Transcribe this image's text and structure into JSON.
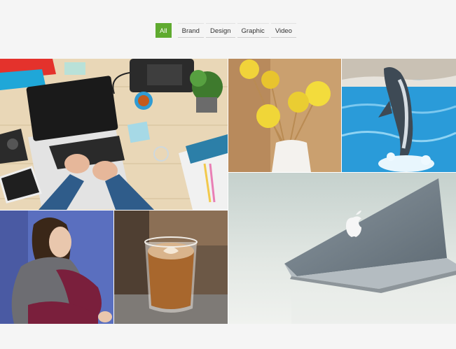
{
  "filters": [
    {
      "label": "All",
      "active": true
    },
    {
      "label": "Brand",
      "active": false
    },
    {
      "label": "Design",
      "active": false
    },
    {
      "label": "Graphic",
      "active": false
    },
    {
      "label": "Video",
      "active": false
    }
  ],
  "colors": {
    "accent": "#5faa2f",
    "page_background": "#f5f5f5"
  },
  "gallery": [
    {
      "subject": "workspace-desk-laptop-photo"
    },
    {
      "subject": "yellow-flowers-vase-photo"
    },
    {
      "subject": "dolphin-jumping-photo"
    },
    {
      "subject": "woman-portrait-photo"
    },
    {
      "subject": "latte-coffee-glass-photo"
    },
    {
      "subject": "macbook-laptop-photo"
    }
  ]
}
